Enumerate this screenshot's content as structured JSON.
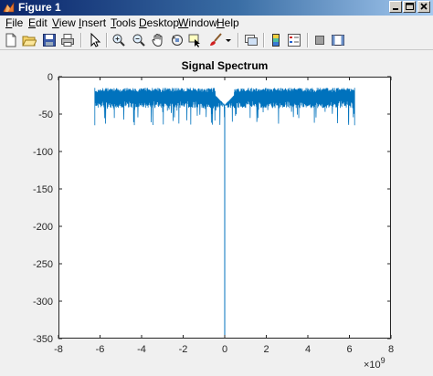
{
  "window": {
    "title": "Figure 1"
  },
  "menu": {
    "items": [
      "File",
      "Edit",
      "View",
      "Insert",
      "Tools",
      "Desktop",
      "Window",
      "Help"
    ],
    "mnemonics": [
      "F",
      "E",
      "V",
      "I",
      "T",
      "D",
      "W",
      "H"
    ]
  },
  "toolbar": {
    "icons": [
      "new-figure-icon",
      "open-file-icon",
      "save-figure-icon",
      "print-figure-icon",
      "edit-plot-icon",
      "zoom-in-icon",
      "zoom-out-icon",
      "pan-icon",
      "rotate-3d-icon",
      "data-cursor-icon",
      "brush-icon",
      "brush-dropdown-icon",
      "link-plot-icon",
      "insert-colorbar-icon",
      "insert-legend-icon",
      "hide-plot-tools-icon",
      "show-plot-tools-icon"
    ]
  },
  "colors": {
    "line": "#0072bd",
    "axes_background": "#ffffff",
    "figure_background": "#f0f0f0"
  },
  "chart_data": {
    "type": "line",
    "title": "Signal Spectrum",
    "xlabel": "",
    "ylabel": "",
    "xlim": [
      -8,
      8
    ],
    "ylim": [
      -350,
      0
    ],
    "x_exponent_label": "×10",
    "x_exponent_power": "9",
    "xticks": [
      -8,
      -6,
      -4,
      -2,
      0,
      2,
      4,
      6,
      8
    ],
    "yticks": [
      0,
      -50,
      -100,
      -150,
      -200,
      -250,
      -300,
      -350
    ],
    "xtick_labels": [
      "-8",
      "-6",
      "-4",
      "-2",
      "0",
      "2",
      "4",
      "6",
      "8"
    ],
    "ytick_labels": [
      "0",
      "-50",
      "-100",
      "-150",
      "-200",
      "-250",
      "-300",
      "-350"
    ],
    "grid": false,
    "series": [
      {
        "x_range": [
          -6.25,
          6.25
        ],
        "band_top": -15,
        "band_bottom": -40,
        "spike_min": -65,
        "dip_near_zero": -40,
        "null_at_zero": -350
      }
    ]
  }
}
